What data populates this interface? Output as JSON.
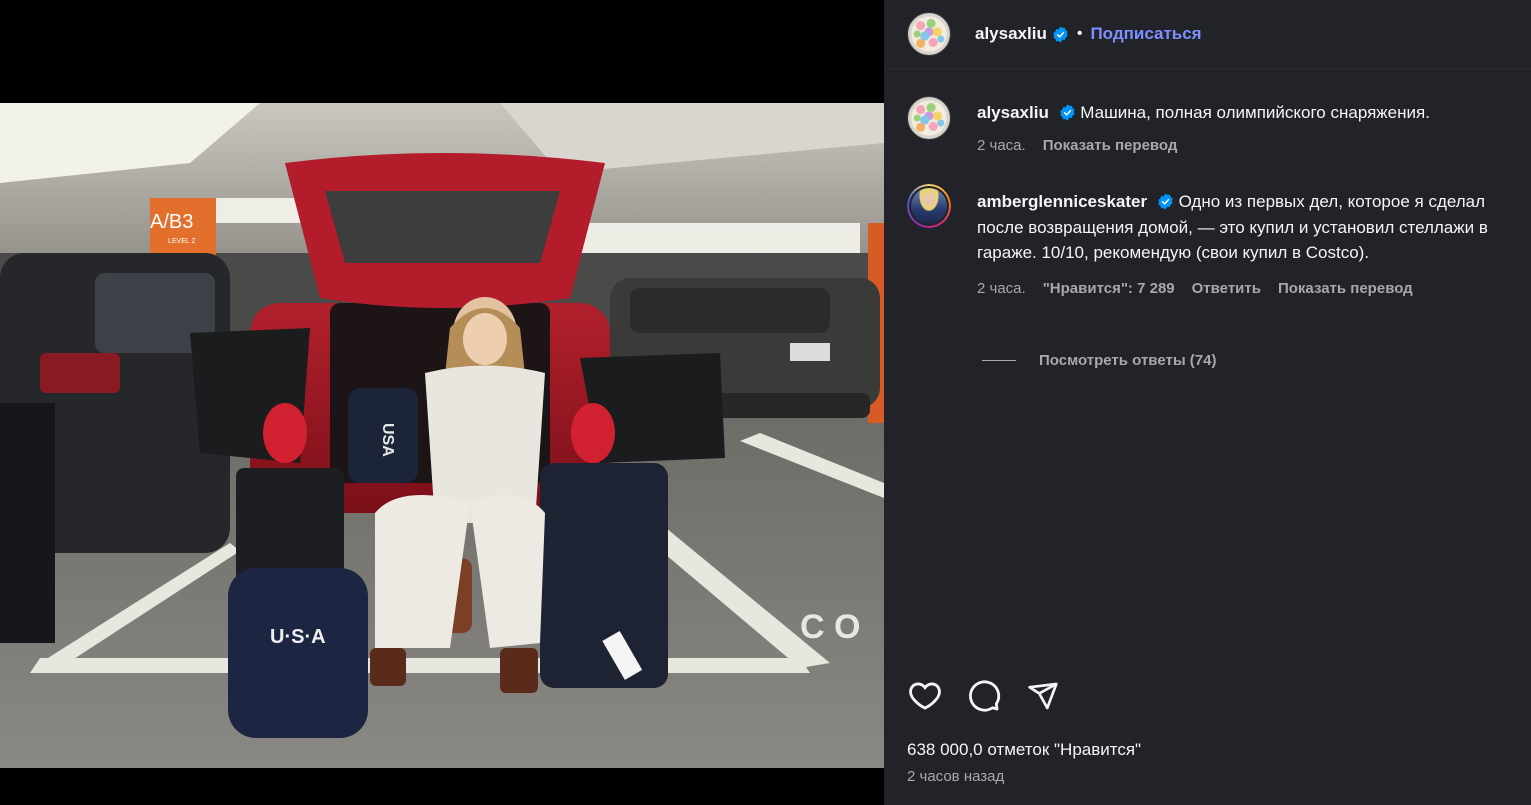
{
  "post": {
    "author": "alysaxliu",
    "follow_label": "Подписаться",
    "separator": "•",
    "image_alt_text": {
      "pillar_sign": "A/B3",
      "pillar_sub": "LEVEL 2",
      "bag_text_1": "U·S·A",
      "bag_text_2": "U·S·A",
      "floor_text": "C O"
    }
  },
  "caption": {
    "author": "alysaxliu",
    "text": "Машина, полная олимпийского снаряжения.",
    "time": "2 часа.",
    "translate_label": "Показать перевод"
  },
  "comment": {
    "author": "amberglenniceskater",
    "text": "Одно из первых дел, которое я сделал после возвращения домой, — это купил и установил стеллажи в гараже. 10/10, рекомендую (свои купил в Costco).",
    "time": "2 часа.",
    "likes_label": "\"Нравится\": 7 289",
    "reply_label": "Ответить",
    "translate_label": "Показать перевод",
    "view_replies_label": "Посмотреть ответы (74)"
  },
  "footer": {
    "likes_count": "638 000,0 отметок \"Нравится\"",
    "posted_ago": "2 часов назад"
  },
  "icons": {
    "like": "heart-icon",
    "comment": "comment-icon",
    "share": "send-icon",
    "verified": "verified-badge-icon"
  },
  "colors": {
    "panel_bg": "#212328",
    "follow": "#7d8fff",
    "verified": "#0095f6",
    "muted": "#a8a8a8"
  }
}
